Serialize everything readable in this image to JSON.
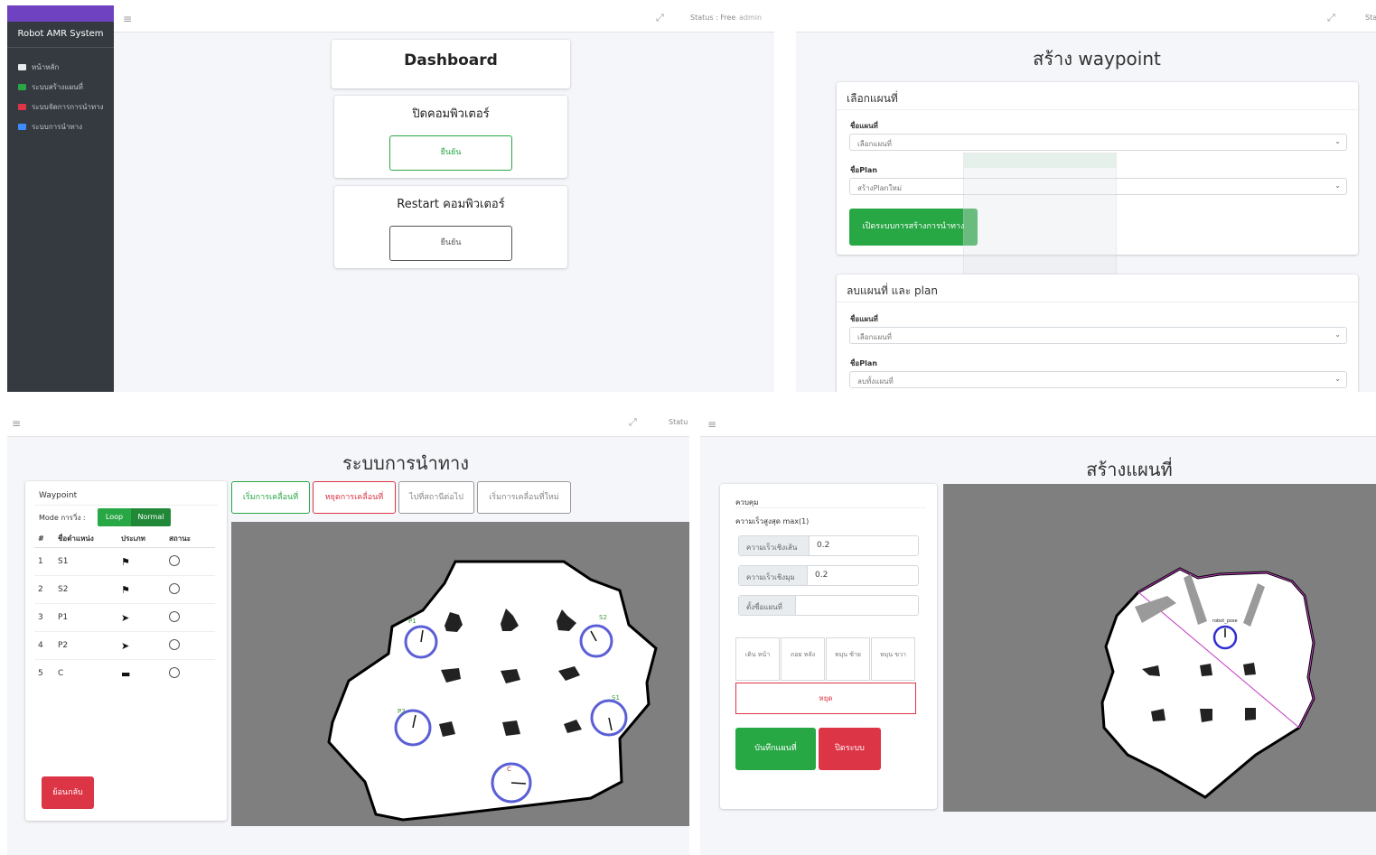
{
  "panel1": {
    "brand": "Robot AMR System",
    "nav": [
      {
        "label": "หน้าหลัก",
        "icon": "home-icon",
        "color": "#e9ecef"
      },
      {
        "label": "ระบบสร้างแผนที่",
        "icon": "map-icon",
        "color": "#28a745"
      },
      {
        "label": "ระบบจัดการการนำทาง",
        "icon": "marker-icon",
        "color": "#dc3545"
      },
      {
        "label": "ระบบการนำทาง",
        "icon": "plane-icon",
        "color": "#3d8bfd"
      }
    ],
    "status": "Status : Free",
    "user": "admin",
    "title": "Dashboard",
    "shutdown": {
      "title": "ปิดคอมพิวเตอร์",
      "button": "ยืนยัน"
    },
    "restart": {
      "title": "Restart คอมพิวเตอร์",
      "button": "ยืนยัน"
    }
  },
  "panel2": {
    "title": "สร้าง waypoint",
    "status": "Sta",
    "select_card": {
      "title": "เลือกแผนที่",
      "map_label": "ชื่อแผนที่",
      "map_value": "เลือกแผนที่",
      "plan_label": "ชื่อPlan",
      "plan_value": "สร้างPlanใหม่",
      "button": "เปิดระบบการสร้างการนำทาง"
    },
    "delete_card": {
      "title": "ลบแผนที่ และ plan",
      "map_label": "ชื่อแผนที่",
      "map_value": "เลือกแผนที่",
      "plan_label": "ชื่อPlan",
      "plan_value": "ลบทั้งแผนที่"
    }
  },
  "panel3": {
    "title": "ระบบการนำทาง",
    "status": "Statu",
    "waypoint_title": "Waypoint",
    "mode_label": "Mode การวิ่ง :",
    "mode_loop": "Loop",
    "mode_normal": "Normal",
    "columns": [
      "#",
      "ชื่อตำแหน่ง",
      "ประเภท",
      "สถานะ"
    ],
    "rows": [
      {
        "num": "1",
        "name": "S1",
        "type": "flag-icon"
      },
      {
        "num": "2",
        "name": "S2",
        "type": "flag-icon"
      },
      {
        "num": "3",
        "name": "P1",
        "type": "plane-icon"
      },
      {
        "num": "4",
        "name": "P2",
        "type": "plane-icon"
      },
      {
        "num": "5",
        "name": "C",
        "type": "battery-icon"
      }
    ],
    "buttons": [
      "เริ่มการเคลื่อนที่",
      "หยุดการเคลื่อนที่",
      "ไปที่สถานีต่อไป",
      "เริ่มการเคลื่อนที่ใหม่"
    ],
    "back_button": "ย้อนกลับ",
    "map_labels": {
      "P1": "P1",
      "S2": "S2",
      "P2": "P2",
      "S1": "S1",
      "C": "C"
    }
  },
  "panel4": {
    "title": "สร้างแผนที่",
    "control_title": "ควบคุม",
    "max_speed_label": "ความเร็วสูงสุด max(1)",
    "linear_label": "ความเร็วเชิงเส้น",
    "linear_value": "0.2",
    "angular_label": "ความเร็วเชิงมุม",
    "angular_value": "0.2",
    "mapname_label": "ตั้งชื่อแผนที่",
    "mapname_value": "",
    "controls": [
      "เดิน หน้า",
      "ถอย หลัง",
      "หมุน ซ้าย",
      "หมุน ขวา"
    ],
    "stop": "หยุด",
    "save": "บันทึกแผนที่",
    "close": "ปิดระบบ",
    "robot_label": "robot_pose"
  }
}
